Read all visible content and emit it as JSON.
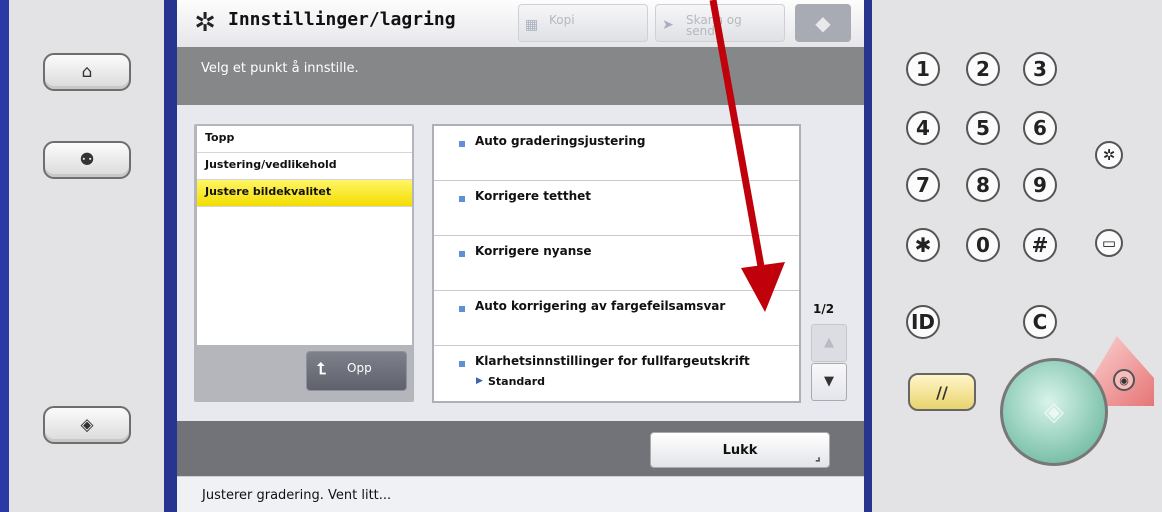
{
  "header": {
    "title": "Innstillinger/lagring",
    "title_icon": "settings-asterisk",
    "tabs": [
      {
        "label": "Kopi",
        "icon": "copy-icon"
      },
      {
        "label": "Skann og\nsend",
        "icon": "send-icon"
      }
    ],
    "box_icon": "box-icon"
  },
  "instruction": "Velg et punkt å innstille.",
  "nav": {
    "items": [
      {
        "label": "Topp",
        "selected": false
      },
      {
        "label": "Justering/vedlikehold",
        "selected": false
      },
      {
        "label": "Justere bildekvalitet",
        "selected": true
      }
    ],
    "up_button": "Opp"
  },
  "options": [
    {
      "label": "Auto graderingsjustering"
    },
    {
      "label": "Korrigere tetthet"
    },
    {
      "label": "Korrigere nyanse"
    },
    {
      "label": "Auto korrigering av fargefeilsamsvar"
    },
    {
      "label": "Klarhetsinnstillinger for fullfargeutskrift",
      "value": "Standard"
    }
  ],
  "pager": {
    "indicator": "1/2"
  },
  "footer": {
    "close_button": "Lukk"
  },
  "status": "Justerer gradering. Vent litt...",
  "keypad": {
    "keys": [
      "1",
      "2",
      "3",
      "4",
      "5",
      "6",
      "7",
      "8",
      "9",
      "✱",
      "0",
      "#"
    ],
    "id_key": "ID",
    "clear_key": "C",
    "reset_key": "//"
  },
  "colors": {
    "selected_item": "#f6e300",
    "annotation_arrow": "#c0000b",
    "bezel": "#28358f"
  }
}
